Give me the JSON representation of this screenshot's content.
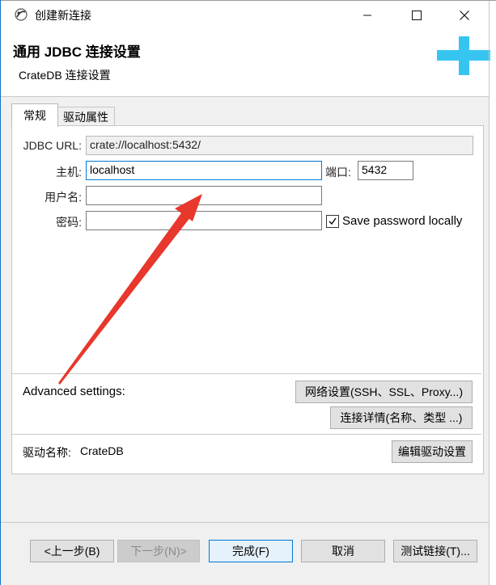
{
  "window": {
    "title": "创建新连接"
  },
  "header": {
    "title": "通用 JDBC 连接设置",
    "subtitle": "CrateDB 连接设置"
  },
  "tabs": [
    {
      "label": "常规"
    },
    {
      "label": "驱动属性"
    }
  ],
  "form": {
    "jdbc_url_label": "JDBC URL:",
    "jdbc_url_value": "crate://localhost:5432/",
    "host_label": "主机:",
    "host_value": "localhost",
    "port_label": "端口:",
    "port_value": "5432",
    "user_label": "用户名:",
    "user_value": "",
    "password_label": "密码:",
    "password_value": "",
    "save_password_label": "Save password locally",
    "save_password_checked": true
  },
  "advanced": {
    "label": "Advanced settings:",
    "network_button": "网络设置(SSH、SSL、Proxy...)",
    "details_button": "连接详情(名称、类型 ...)"
  },
  "driver": {
    "label": "驱动名称:",
    "name": "CrateDB",
    "edit_button": "编辑驱动设置"
  },
  "footer": {
    "back_button": "<上一步(B)",
    "next_button": "下一步(N)>",
    "finish_button": "完成(F)",
    "cancel_button": "取消",
    "test_button": "测试链接(T)..."
  },
  "colors": {
    "accent": "#0078d7",
    "logo": "#36c5f0",
    "arrow": "#e8372c"
  }
}
